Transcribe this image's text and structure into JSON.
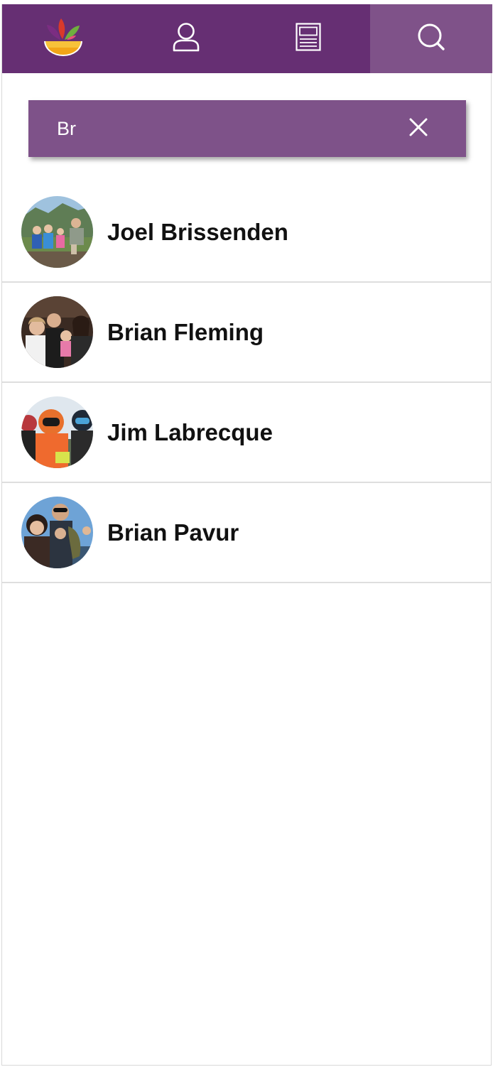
{
  "nav": {
    "tabs": [
      {
        "icon": "app-logo-icon",
        "active": false
      },
      {
        "icon": "profile-icon",
        "active": false
      },
      {
        "icon": "feed-icon",
        "active": false
      },
      {
        "icon": "search-icon",
        "active": true
      }
    ]
  },
  "search": {
    "value": "Br",
    "clear_icon": "close-icon"
  },
  "results": [
    {
      "name": "Joel Brissenden"
    },
    {
      "name": "Brian Fleming"
    },
    {
      "name": "Jim Labrecque"
    },
    {
      "name": "Brian Pavur"
    }
  ],
  "colors": {
    "nav_background": "#662f73",
    "nav_active": "#7f5289",
    "search_background": "#7e5289",
    "divider": "#dedede"
  }
}
